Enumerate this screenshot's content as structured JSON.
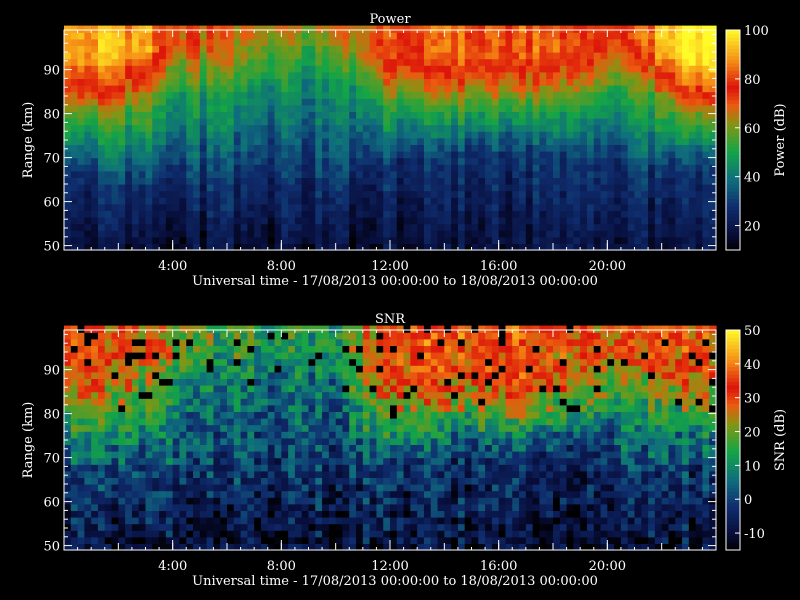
{
  "window": {
    "background": "#000000",
    "foreground": "#ffffff"
  },
  "chart_data": [
    {
      "type": "heatmap",
      "title": "Power",
      "xlabel": "Universal time - 17/08/2013 00:00:00 to 18/08/2013 00:00:00",
      "ylabel": "Range (km)",
      "x_ticks": [
        {
          "hour": 4,
          "label": "4:00"
        },
        {
          "hour": 8,
          "label": "8:00"
        },
        {
          "hour": 12,
          "label": "12:00"
        },
        {
          "hour": 16,
          "label": "16:00"
        },
        {
          "hour": 20,
          "label": "20:00"
        }
      ],
      "xlim_hours": [
        0,
        24
      ],
      "y_ticks": [
        50,
        60,
        70,
        80,
        90
      ],
      "ylim": [
        49,
        99
      ],
      "colorbar": {
        "label": "Power (dB)",
        "range": [
          10,
          100
        ],
        "ticks": [
          20,
          40,
          60,
          80,
          100
        ]
      },
      "value_range": [
        10,
        100
      ],
      "time_bin_hours": 0.25,
      "range_bin_km": 1.5,
      "profile_hours": [
        0,
        1,
        2,
        3,
        4,
        5,
        6,
        7,
        8,
        9,
        10,
        11,
        12,
        13,
        14,
        15,
        16,
        17,
        18,
        19,
        20,
        21,
        22,
        23,
        24
      ],
      "strong_echo_top_km": [
        82,
        81,
        82,
        84,
        85,
        86,
        86,
        87,
        88,
        89,
        88,
        84,
        83,
        83,
        83,
        83,
        83,
        83,
        84,
        84,
        86,
        87,
        84,
        82,
        82
      ],
      "noise_floor_km": [
        66,
        66,
        63,
        63,
        63,
        64,
        64,
        65,
        66,
        66,
        64,
        66,
        68,
        69,
        70,
        70,
        70,
        70,
        70,
        70,
        70,
        66,
        66,
        68,
        68
      ],
      "top_level_db": [
        90,
        90,
        90,
        90,
        72,
        70,
        68,
        66,
        64,
        62,
        64,
        72,
        80,
        82,
        83,
        83,
        82,
        82,
        80,
        76,
        74,
        80,
        95,
        98,
        98
      ]
    },
    {
      "type": "heatmap",
      "title": "SNR",
      "xlabel": "Universal time - 17/08/2013 00:00:00 to 18/08/2013 00:00:00",
      "ylabel": "Range (km)",
      "x_ticks": [
        {
          "hour": 4,
          "label": "4:00"
        },
        {
          "hour": 8,
          "label": "8:00"
        },
        {
          "hour": 12,
          "label": "12:00"
        },
        {
          "hour": 16,
          "label": "16:00"
        },
        {
          "hour": 20,
          "label": "20:00"
        }
      ],
      "xlim_hours": [
        0,
        24
      ],
      "y_ticks": [
        50,
        60,
        70,
        80,
        90
      ],
      "ylim": [
        49,
        99
      ],
      "colorbar": {
        "label": "SNR (dB)",
        "range": [
          -15,
          50
        ],
        "ticks": [
          -10,
          0,
          10,
          20,
          30,
          40,
          50
        ]
      },
      "value_range": [
        -15,
        50
      ],
      "time_bin_hours": 0.25,
      "range_bin_km": 1.5,
      "profile_hours": [
        0,
        1,
        2,
        3,
        4,
        5,
        6,
        7,
        8,
        9,
        10,
        11,
        12,
        13,
        14,
        15,
        16,
        17,
        18,
        19,
        20,
        21,
        22,
        23,
        24
      ],
      "strong_echo_top_km": [
        80,
        79,
        80,
        82,
        84,
        85,
        86,
        86,
        87,
        88,
        86,
        80,
        78,
        80,
        80,
        80,
        79,
        79,
        80,
        80,
        82,
        83,
        82,
        80,
        80
      ],
      "noise_floor_km": [
        66,
        66,
        63,
        63,
        63,
        64,
        64,
        65,
        66,
        66,
        64,
        66,
        68,
        69,
        70,
        70,
        70,
        70,
        70,
        70,
        70,
        66,
        66,
        68,
        68
      ],
      "top_level_db": [
        30,
        30,
        30,
        28,
        20,
        18,
        16,
        14,
        14,
        14,
        16,
        26,
        32,
        34,
        34,
        34,
        33,
        33,
        32,
        30,
        28,
        30,
        33,
        30,
        30
      ]
    }
  ]
}
